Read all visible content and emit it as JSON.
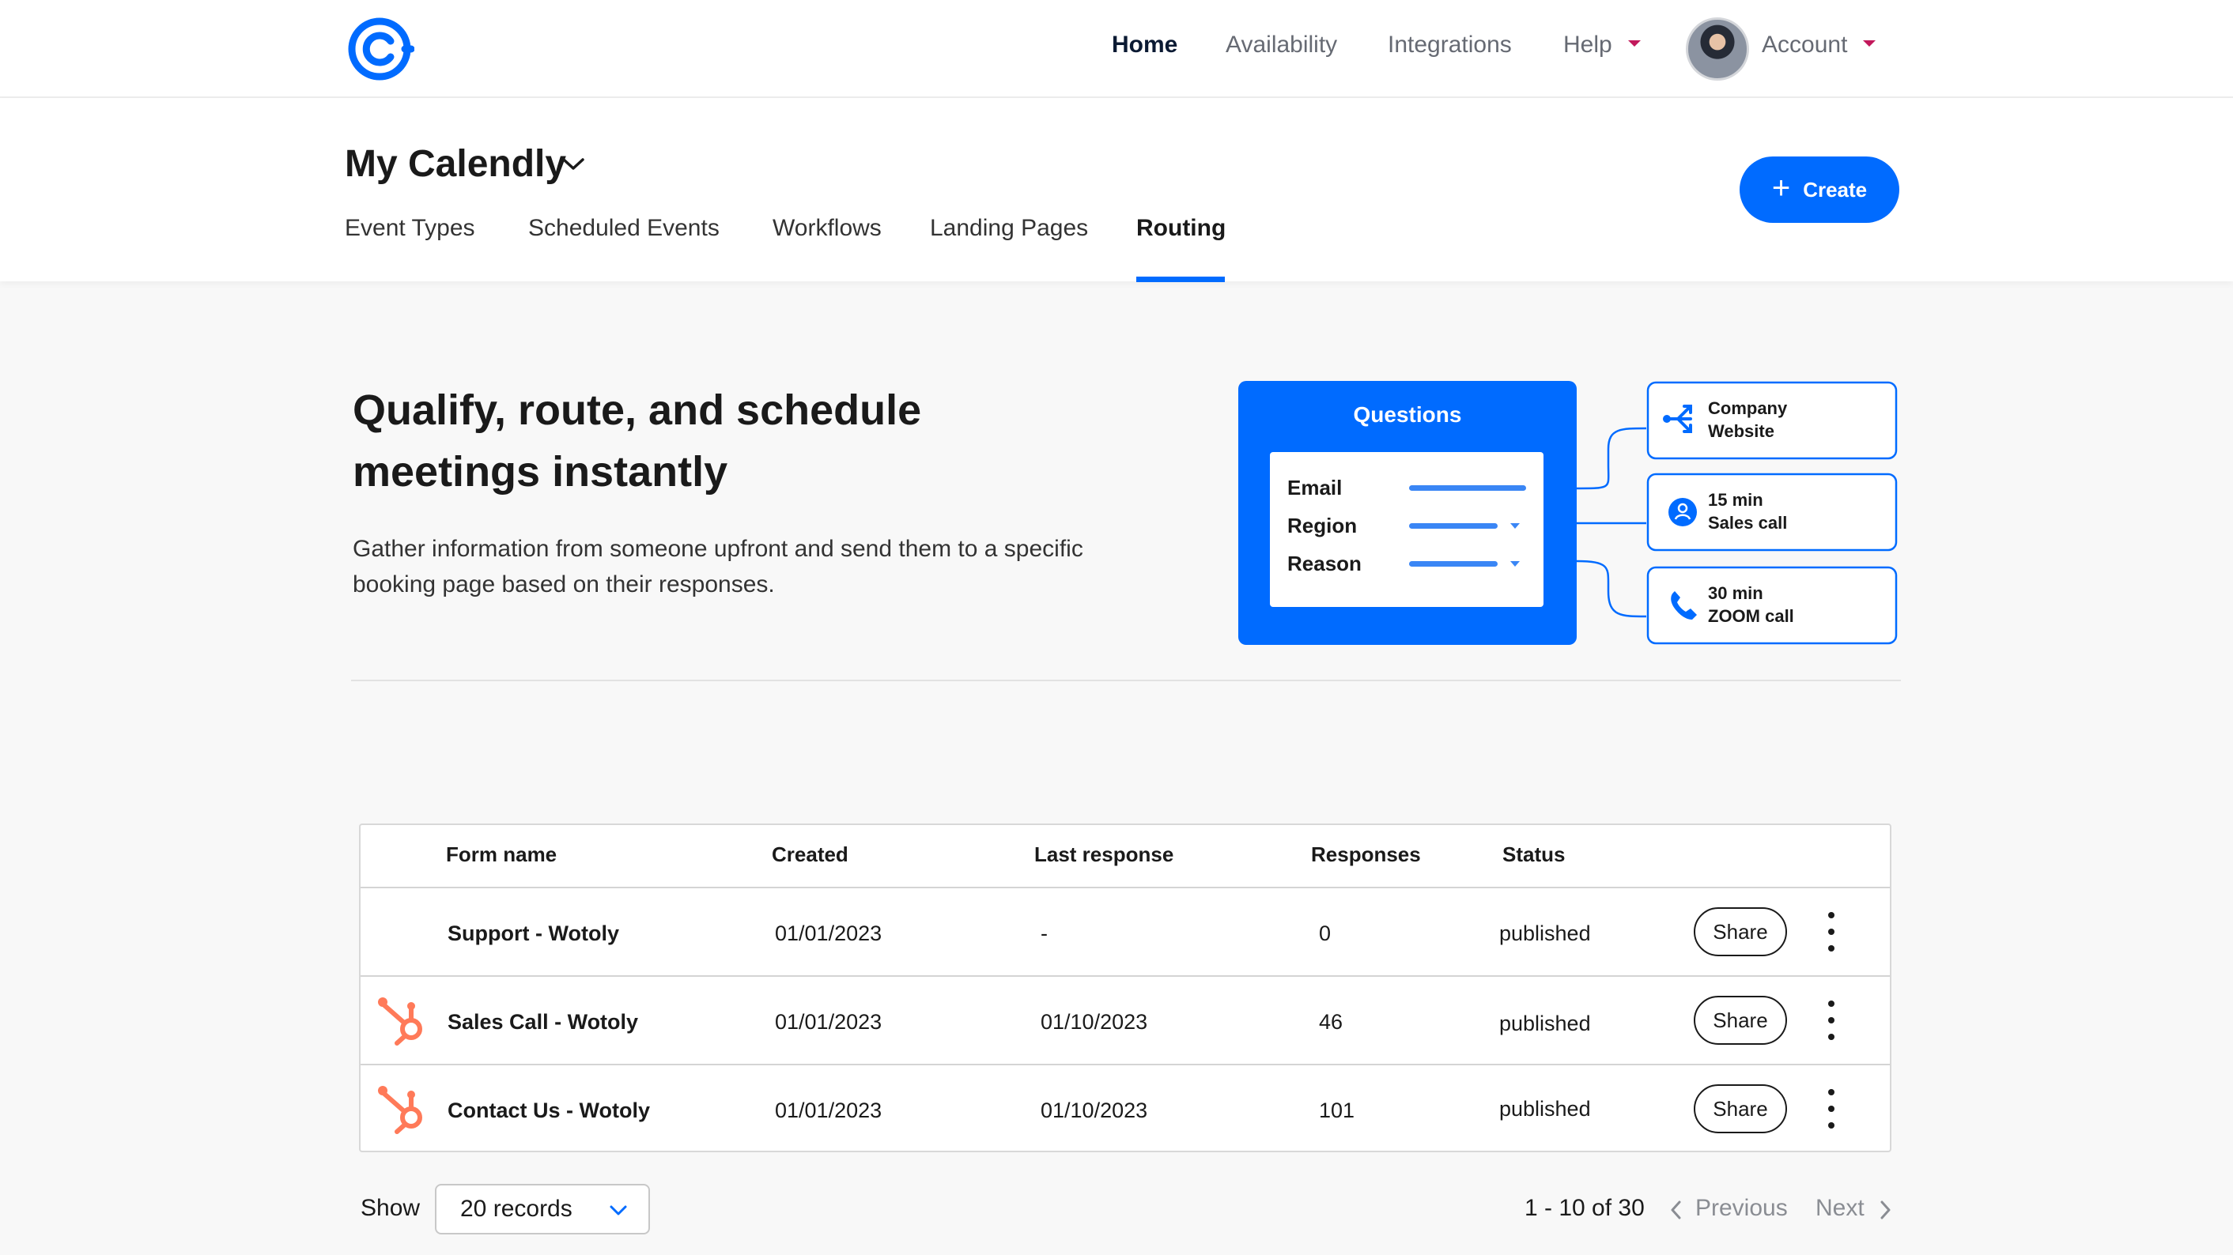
{
  "nav": {
    "items": [
      {
        "label": "Home",
        "active": true
      },
      {
        "label": "Availability"
      },
      {
        "label": "Integrations"
      },
      {
        "label": "Help"
      },
      {
        "label": "Account"
      }
    ]
  },
  "header": {
    "title": "My Calendly",
    "tabs": [
      {
        "label": "Event Types"
      },
      {
        "label": "Scheduled Events"
      },
      {
        "label": "Workflows"
      },
      {
        "label": "Landing Pages"
      },
      {
        "label": "Routing",
        "active": true
      }
    ],
    "create_label": "Create"
  },
  "hero": {
    "title_line1": "Qualify, route, and schedule",
    "title_line2": "meetings instantly",
    "desc_line1": "Gather information from someone upfront and send them to a specific",
    "desc_line2": "booking page based on their responses.",
    "illustration": {
      "questions_title": "Questions",
      "fields": [
        "Email",
        "Region",
        "Reason"
      ],
      "destinations": [
        {
          "line1": "Company",
          "line2": "Website",
          "icon": "route-icon"
        },
        {
          "line1": "15 min",
          "line2": "Sales call",
          "icon": "user-icon"
        },
        {
          "line1": "30 min",
          "line2": "ZOOM call",
          "icon": "phone-icon"
        }
      ]
    }
  },
  "table": {
    "columns": [
      "Form name",
      "Created",
      "Last response",
      "Responses",
      "Status"
    ],
    "rows": [
      {
        "name": "Support - Wotoly",
        "created": "01/01/2023",
        "last_response": "-",
        "responses": "0",
        "status": "published",
        "share": "Share",
        "hubspot": false
      },
      {
        "name": "Sales Call - Wotoly",
        "created": "01/01/2023",
        "last_response": "01/10/2023",
        "responses": "46",
        "status": "published",
        "share": "Share",
        "hubspot": true
      },
      {
        "name": "Contact Us - Wotoly",
        "created": "01/01/2023",
        "last_response": "01/10/2023",
        "responses": "101",
        "status": "published",
        "share": "Share",
        "hubspot": true
      }
    ]
  },
  "pagination": {
    "show_label": "Show",
    "records_value": "20 records",
    "range": "1 - 10 of 30",
    "previous": "Previous",
    "next": "Next"
  },
  "colors": {
    "brand_blue": "#006bff",
    "hubspot_orange": "#ff7a59",
    "caret_red": "#c2185b"
  }
}
